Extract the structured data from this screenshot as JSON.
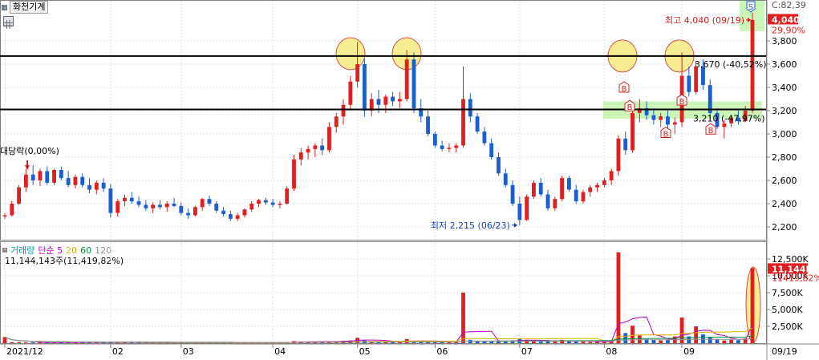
{
  "toolbar": {
    "title": "화천기계"
  },
  "price_panel": {
    "axis_ticks": [
      "2,200",
      "2,400",
      "2,600",
      "2,800",
      "3,000",
      "3,200",
      "3,400",
      "3,600",
      "3,800"
    ],
    "last_price": "4,040",
    "change_pct": "29,90%",
    "cut_label": "C:82,39",
    "high_label": "최고 4,040 (09/19)",
    "low_label": "최저 2,215 (06/23)",
    "line_upper_label": "3,670 (-40,52%)",
    "line_lower_label": "3,210 (-47,97%)",
    "start_label": "대당락(0,00%)",
    "sell_marker": "S",
    "buy_marker": "B"
  },
  "volume_panel": {
    "legend": [
      {
        "label": "거래량",
        "color": "#00a0a0"
      },
      {
        "label": "단순 5",
        "color": "#c000c0"
      },
      {
        "label": "20",
        "color": "#e0b000"
      },
      {
        "label": "60",
        "color": "#009040"
      },
      {
        "label": "120",
        "color": "#909090"
      }
    ],
    "value_text": "11,144,143주(11,419,82%)",
    "axis_ticks": [
      "2,500K",
      "5,000K",
      "7,500K",
      "10,000K",
      "12,500K"
    ],
    "last_volume": "11,144K",
    "last_pct": "11419,82%"
  },
  "x_axis": {
    "labels": [
      "2021/12",
      "02",
      "03",
      "04",
      "05",
      "06",
      "07",
      "08",
      "09",
      "09/19"
    ]
  },
  "chart_data": {
    "type": "candlestick",
    "y_range": [
      2150,
      4000
    ],
    "volume_range": [
      0,
      13750
    ],
    "horizontal_lines": [
      3670,
      3210
    ],
    "high": {
      "value": 4040,
      "date": "09/19"
    },
    "low": {
      "value": 2215,
      "date": "06/23"
    },
    "series": [
      {
        "name": "price",
        "points": [
          [
            2290,
            2320,
            2270,
            2300
          ],
          [
            2300,
            2420,
            2290,
            2400
          ],
          [
            2400,
            2560,
            2390,
            2540
          ],
          [
            2540,
            2700,
            2500,
            2650
          ],
          [
            2650,
            2730,
            2560,
            2600
          ],
          [
            2600,
            2700,
            2550,
            2680
          ],
          [
            2680,
            2720,
            2560,
            2580
          ],
          [
            2580,
            2700,
            2560,
            2690
          ],
          [
            2690,
            2720,
            2600,
            2620
          ],
          [
            2620,
            2680,
            2540,
            2560
          ],
          [
            2560,
            2650,
            2530,
            2630
          ],
          [
            2630,
            2660,
            2540,
            2560
          ],
          [
            2560,
            2620,
            2490,
            2520
          ],
          [
            2520,
            2600,
            2480,
            2580
          ],
          [
            2580,
            2620,
            2500,
            2530
          ],
          [
            2530,
            2570,
            2280,
            2320
          ],
          [
            2320,
            2440,
            2290,
            2420
          ],
          [
            2420,
            2480,
            2380,
            2450
          ],
          [
            2450,
            2500,
            2400,
            2420
          ],
          [
            2420,
            2460,
            2370,
            2390
          ],
          [
            2390,
            2430,
            2340,
            2360
          ],
          [
            2360,
            2410,
            2320,
            2390
          ],
          [
            2390,
            2430,
            2350,
            2370
          ],
          [
            2370,
            2420,
            2330,
            2400
          ],
          [
            2400,
            2450,
            2370,
            2380
          ],
          [
            2380,
            2410,
            2300,
            2320
          ],
          [
            2320,
            2360,
            2270,
            2300
          ],
          [
            2300,
            2380,
            2290,
            2370
          ],
          [
            2370,
            2450,
            2340,
            2440
          ],
          [
            2440,
            2470,
            2380,
            2400
          ],
          [
            2400,
            2420,
            2320,
            2340
          ],
          [
            2340,
            2370,
            2290,
            2310
          ],
          [
            2310,
            2340,
            2250,
            2270
          ],
          [
            2270,
            2320,
            2250,
            2300
          ],
          [
            2300,
            2360,
            2280,
            2350
          ],
          [
            2350,
            2420,
            2330,
            2400
          ],
          [
            2400,
            2440,
            2370,
            2430
          ],
          [
            2430,
            2450,
            2390,
            2410
          ],
          [
            2410,
            2440,
            2370,
            2390
          ],
          [
            2390,
            2420,
            2360,
            2400
          ],
          [
            2400,
            2550,
            2390,
            2530
          ],
          [
            2530,
            2820,
            2510,
            2780
          ],
          [
            2780,
            2880,
            2730,
            2840
          ],
          [
            2840,
            2900,
            2780,
            2870
          ],
          [
            2870,
            2920,
            2800,
            2900
          ],
          [
            2900,
            2960,
            2820,
            2860
          ],
          [
            2860,
            3100,
            2840,
            3060
          ],
          [
            3060,
            3180,
            3010,
            3150
          ],
          [
            3150,
            3300,
            3080,
            3250
          ],
          [
            3250,
            3500,
            3200,
            3450
          ],
          [
            3450,
            3790,
            3400,
            3600
          ],
          [
            3600,
            3650,
            3150,
            3200
          ],
          [
            3200,
            3350,
            3150,
            3300
          ],
          [
            3300,
            3380,
            3180,
            3250
          ],
          [
            3250,
            3340,
            3180,
            3320
          ],
          [
            3320,
            3360,
            3240,
            3280
          ],
          [
            3280,
            3360,
            3220,
            3300
          ],
          [
            3300,
            3720,
            3280,
            3640
          ],
          [
            3640,
            3700,
            3180,
            3220
          ],
          [
            3220,
            3300,
            3100,
            3150
          ],
          [
            3150,
            3200,
            2980,
            3000
          ],
          [
            3000,
            3020,
            2880,
            2900
          ],
          [
            2900,
            2940,
            2850,
            2870
          ],
          [
            2870,
            2920,
            2840,
            2880
          ],
          [
            2880,
            2920,
            2840,
            2900
          ],
          [
            2900,
            3580,
            2880,
            3300
          ],
          [
            3300,
            3350,
            3100,
            3150
          ],
          [
            3150,
            3180,
            3000,
            3020
          ],
          [
            3020,
            3060,
            2900,
            2920
          ],
          [
            2920,
            2960,
            2780,
            2800
          ],
          [
            2800,
            2840,
            2640,
            2660
          ],
          [
            2660,
            2700,
            2540,
            2560
          ],
          [
            2560,
            2600,
            2380,
            2400
          ],
          [
            2400,
            2460,
            2215,
            2260
          ],
          [
            2260,
            2480,
            2250,
            2460
          ],
          [
            2460,
            2600,
            2440,
            2580
          ],
          [
            2580,
            2620,
            2460,
            2480
          ],
          [
            2480,
            2520,
            2340,
            2360
          ],
          [
            2360,
            2460,
            2340,
            2440
          ],
          [
            2440,
            2640,
            2420,
            2620
          ],
          [
            2620,
            2640,
            2500,
            2520
          ],
          [
            2520,
            2560,
            2400,
            2420
          ],
          [
            2420,
            2520,
            2400,
            2500
          ],
          [
            2500,
            2560,
            2460,
            2540
          ],
          [
            2540,
            2580,
            2500,
            2560
          ],
          [
            2560,
            2620,
            2540,
            2600
          ],
          [
            2600,
            2700,
            2560,
            2680
          ],
          [
            2680,
            2990,
            2640,
            2960
          ],
          [
            2960,
            3020,
            2820,
            2860
          ],
          [
            2860,
            3220,
            2840,
            3180
          ],
          [
            3180,
            3300,
            3100,
            3220
          ],
          [
            3220,
            3280,
            3120,
            3160
          ],
          [
            3160,
            3220,
            3080,
            3120
          ],
          [
            3120,
            3180,
            3060,
            3150
          ],
          [
            3150,
            3200,
            3050,
            3080
          ],
          [
            3080,
            3140,
            3000,
            3100
          ],
          [
            3100,
            3700,
            3060,
            3500
          ],
          [
            3500,
            3580,
            3320,
            3360
          ],
          [
            3360,
            3620,
            3340,
            3580
          ],
          [
            3580,
            3640,
            3380,
            3420
          ],
          [
            3420,
            3470,
            3140,
            3180
          ],
          [
            3180,
            3220,
            3040,
            3060
          ],
          [
            3060,
            3120,
            2960,
            3090
          ],
          [
            3090,
            3160,
            3060,
            3140
          ],
          [
            3140,
            3200,
            3080,
            3110
          ],
          [
            3110,
            3240,
            3100,
            3200
          ],
          [
            3200,
            4040,
            3180,
            3980
          ]
        ]
      },
      {
        "name": "volume",
        "values": [
          900,
          150,
          120,
          100,
          120,
          110,
          100,
          90,
          110,
          100,
          120,
          100,
          90,
          110,
          100,
          130,
          110,
          100,
          90,
          100,
          90,
          80,
          90,
          100,
          90,
          110,
          90,
          80,
          100,
          90,
          90,
          100,
          80,
          90,
          100,
          110,
          90,
          100,
          90,
          100,
          120,
          300,
          250,
          200,
          180,
          220,
          260,
          300,
          350,
          400,
          800,
          500,
          300,
          250,
          200,
          220,
          230,
          600,
          350,
          280,
          220,
          180,
          150,
          140,
          150,
          7500,
          500,
          300,
          250,
          300,
          300,
          350,
          400,
          700,
          500,
          300,
          250,
          300,
          250,
          500,
          300,
          250,
          220,
          200,
          200,
          210,
          300,
          13500,
          1500,
          2600,
          1200,
          600,
          500,
          400,
          450,
          1000,
          3800,
          1000,
          2500,
          1300,
          900,
          600,
          400,
          500,
          450,
          700,
          11144
        ]
      }
    ]
  }
}
